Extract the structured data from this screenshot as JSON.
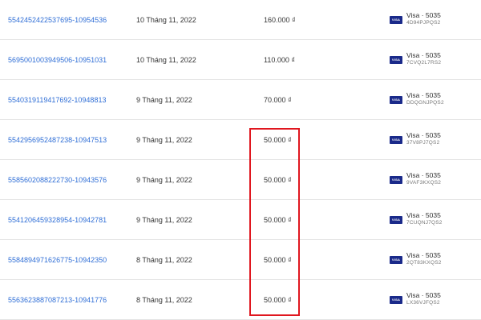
{
  "orders": [
    {
      "id": "5542452422537695-10954536",
      "date": "10 Tháng 11, 2022",
      "amount": "160.000 ₫",
      "payment": {
        "card": "Visa · 5035",
        "ref": "4D94PJPQS2"
      }
    },
    {
      "id": "5695001003949506-10951031",
      "date": "10 Tháng 11, 2022",
      "amount": "110.000 ₫",
      "payment": {
        "card": "Visa · 5035",
        "ref": "7CVQ2L7RS2"
      }
    },
    {
      "id": "5540319119417692-10948813",
      "date": "9 Tháng 11, 2022",
      "amount": "70.000 ₫",
      "payment": {
        "card": "Visa · 5035",
        "ref": "DDQGNJPQS2"
      }
    },
    {
      "id": "5542956952487238-10947513",
      "date": "9 Tháng 11, 2022",
      "amount": "50.000 ₫",
      "payment": {
        "card": "Visa · 5035",
        "ref": "37V8PJ7QS2"
      }
    },
    {
      "id": "5585602088222730-10943576",
      "date": "9 Tháng 11, 2022",
      "amount": "50.000 ₫",
      "payment": {
        "card": "Visa · 5035",
        "ref": "9VAF3KXQS2"
      }
    },
    {
      "id": "5541206459328954-10942781",
      "date": "9 Tháng 11, 2022",
      "amount": "50.000 ₫",
      "payment": {
        "card": "Visa · 5035",
        "ref": "7CUQNJ7QS2"
      }
    },
    {
      "id": "5584894971626775-10942350",
      "date": "8 Tháng 11, 2022",
      "amount": "50.000 ₫",
      "payment": {
        "card": "Visa · 5035",
        "ref": "2QT83KXQS2"
      }
    },
    {
      "id": "5563623887087213-10941776",
      "date": "8 Tháng 11, 2022",
      "amount": "50.000 ₫",
      "payment": {
        "card": "Visa · 5035",
        "ref": "LX36VJFQS2"
      }
    }
  ],
  "visa_badge_label": "VISA",
  "icons": {
    "payment_icon": "visa-card-icon"
  },
  "colors": {
    "link": "#2f6ed6",
    "highlight": "#e0171f",
    "visa": "#1a2a8a"
  }
}
